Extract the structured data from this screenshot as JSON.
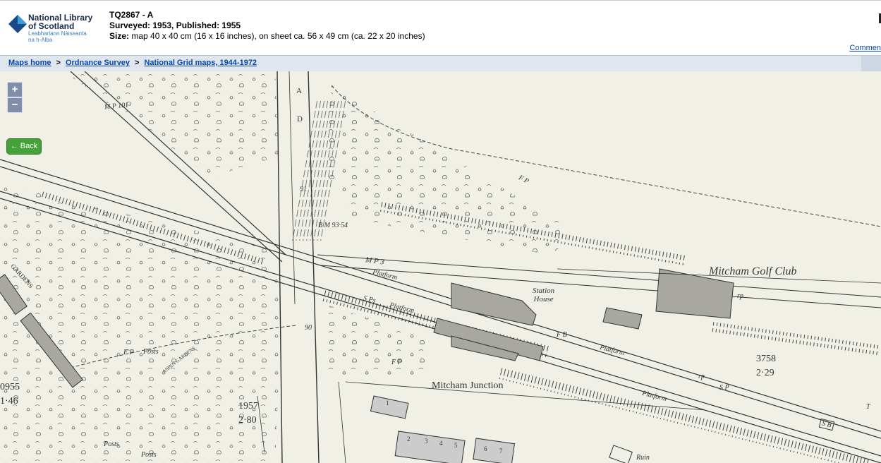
{
  "header": {
    "logo_line1": "National Library",
    "logo_line2": "of Scotland",
    "logo_gaelic1": "Leabharlann Nàiseanta",
    "logo_gaelic2": "na h-Alba",
    "sheet_title": "TQ2867 - A",
    "surveyed_label": "Surveyed: 1953, Published: 1955",
    "size_label": "Size:",
    "size_value": "map 40 x 40 cm (16 x 16 inches), on sheet ca. 56 x 49 cm (ca. 22 x 20 inches)",
    "comment_link": "Commen"
  },
  "breadcrumb": {
    "items": [
      "Maps home",
      "Ordnance Survey",
      "National Grid maps, 1944-1972"
    ],
    "separator": ">"
  },
  "map_controls": {
    "zoom_in": "+",
    "zoom_out": "−",
    "back_label": "← Back"
  },
  "map_labels": {
    "mp101": "M P 101",
    "road_a": "A",
    "road_d": "D",
    "bm": "B M 93·54",
    "v91": "91",
    "v90": "90",
    "mp3": "M P 3",
    "platform1": "Platform",
    "platform2": "Platform",
    "platform3": "Platform",
    "platform4": "Platform",
    "sps": "S Ps",
    "station_house1": "Station",
    "station_house2": "House",
    "fb": "F B",
    "golf_club": "Mitcham Golf Club",
    "rp1": "rp",
    "rp2": "rp",
    "sp": "S P",
    "parcel_3758": "3758",
    "parcel_229": "2·29",
    "junction": "Mitcham Junction",
    "fp1": "F P",
    "fp2": "F P",
    "fp3": "F P",
    "posts1": "Posts",
    "posts2": "Posts",
    "posts3": "Posts",
    "aspen_gardens": "ASPEN GARDENS",
    "gardens": "GARDENS",
    "parcel_1957": "1957",
    "parcel_280": "2·80",
    "parcel_0955": "0955",
    "parcel_146": "1·46",
    "sb": "S B",
    "ruin": "Ruin",
    "t": "T",
    "house_nums": [
      "2",
      "3",
      "4",
      "5",
      "6",
      "7"
    ],
    "house_1": "1"
  },
  "colors": {
    "map_bg": "#f0f0e6",
    "map_ink": "#3a3a3a",
    "building_fill": "#a8a8a0",
    "back_green": "#45a23a",
    "link_blue": "#0645ad",
    "breadcrumb_bg": "#dfe6ee"
  }
}
